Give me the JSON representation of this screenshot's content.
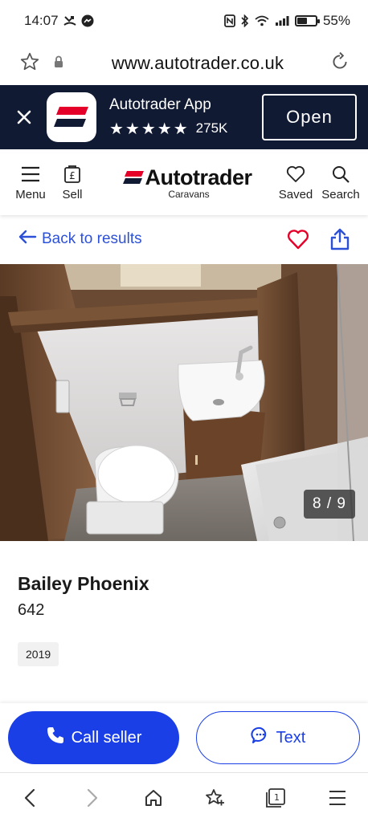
{
  "status_bar": {
    "time": "14:07",
    "battery": "55%",
    "battery_level": 0.55,
    "left_icons": [
      "missed-call-icon",
      "messenger-icon"
    ],
    "right_icons": [
      "nfc-icon",
      "bluetooth-icon",
      "wifi-icon",
      "signal-icon",
      "battery-icon"
    ]
  },
  "browser": {
    "url": "www.autotrader.co.uk",
    "icons": [
      "bookmark-star-icon",
      "lock-icon",
      "reload-icon"
    ]
  },
  "app_banner": {
    "app_name": "Autotrader App",
    "stars": "★★★★★",
    "review_count": "275K",
    "open_label": "Open",
    "background_color": "#111a33"
  },
  "header": {
    "menu_label": "Menu",
    "sell_label": "Sell",
    "logo_text": "Autotrader",
    "logo_sub": "Caravans",
    "saved_label": "Saved",
    "search_label": "Search",
    "brand_color": "#e5002a"
  },
  "back_row": {
    "back_label": "Back to results",
    "link_color": "#2d51d6",
    "icons": [
      "back-arrow-icon",
      "heart-icon",
      "share-icon"
    ]
  },
  "gallery": {
    "counter": "8 / 9",
    "current": 8,
    "total": 9
  },
  "listing": {
    "title": "Bailey Phoenix",
    "model": "642",
    "year": "2019"
  },
  "cta": {
    "call_label": "Call seller",
    "text_label": "Text",
    "accent_color": "#1a3fe6"
  },
  "browser_nav": {
    "icons": [
      "back-icon",
      "forward-icon",
      "home-icon",
      "favourites-icon",
      "tabs-icon",
      "menu-icon"
    ],
    "tab_count": "1"
  }
}
